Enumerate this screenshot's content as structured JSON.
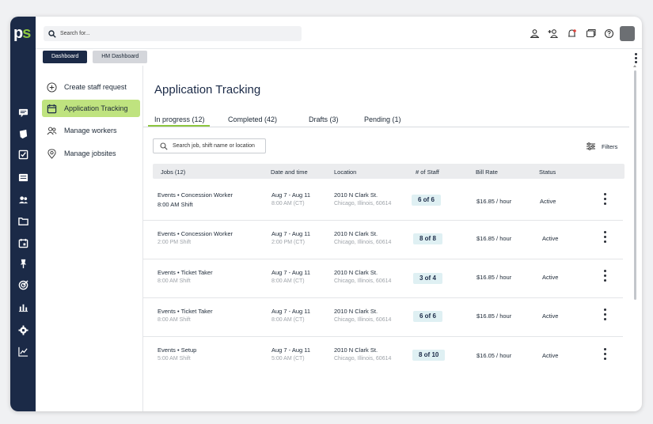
{
  "logo": {
    "p": "p",
    "s": "s"
  },
  "search": {
    "placeholder": "Search for..."
  },
  "subtabs": {
    "dashboard": "Dashboard",
    "hm_dashboard": "HM Dashboard"
  },
  "sidebar": {
    "items": [
      {
        "label": "Create staff request",
        "icon": "plus-circle-icon"
      },
      {
        "label": "Application Tracking",
        "icon": "calendar-icon"
      },
      {
        "label": "Manage workers",
        "icon": "people-icon"
      },
      {
        "label": "Manage jobsites",
        "icon": "location-pin-icon"
      }
    ]
  },
  "rail_icons": [
    "chat-icon",
    "shield-icon",
    "checklist-icon",
    "id-card-icon",
    "users-icon",
    "folder-icon",
    "calendar-icon",
    "pin-icon",
    "target-icon",
    "bar-chart-icon",
    "gear-icon",
    "line-chart-icon"
  ],
  "main": {
    "title": "Application Tracking",
    "tabs": [
      "In progress (12)",
      "Completed (42)",
      "Drafts (3)",
      "Pending (1)"
    ],
    "search_placeholder": "Search job, shift name or location",
    "filters_label": "Filters",
    "columns": [
      "Jobs (12)",
      "Date and time",
      "Location",
      "# of Staff",
      "Bill Rate",
      "Status"
    ],
    "rows": [
      {
        "job": "Events  •  Concession Worker",
        "shift": "8:00 AM Shift",
        "date": "Aug 7 - Aug 11",
        "time": "8:00 AM (CT)",
        "address": "2010 N Clark St.",
        "city": "Chicago, Illinois, 60614",
        "staff": "6 of 6",
        "rate": "$16.85 / hour",
        "status": "Active"
      },
      {
        "job": "Events  •  Concession Worker",
        "shift": "2:00 PM Shift",
        "date": "Aug 7 - Aug 11",
        "time": "2:00 PM (CT)",
        "address": "2010 N Clark St.",
        "city": "Chicago, Illinois, 60614",
        "staff": "8 of 8",
        "rate": "$16.85 / hour",
        "status": "Active"
      },
      {
        "job": "Events  •  Ticket Taker",
        "shift": "8:00 AM Shift",
        "date": "Aug 7 - Aug 11",
        "time": "8:00 AM (CT)",
        "address": "2010 N Clark St.",
        "city": "Chicago, Illinois, 60614",
        "staff": "3 of 4",
        "rate": "$16.85 / hour",
        "status": "Active"
      },
      {
        "job": "Events  •  Ticket Taker",
        "shift": "8:00 AM Shift",
        "date": "Aug 7 - Aug 11",
        "time": "8:00 AM (CT)",
        "address": "2010 N Clark St.",
        "city": "Chicago, Illinois, 60614",
        "staff": "6 of 6",
        "rate": "$16.85 / hour",
        "status": "Active"
      },
      {
        "job": "Events  •  Setup",
        "shift": "5:00 AM Shift",
        "date": "Aug 7 - Aug 11",
        "time": "5:00 AM (CT)",
        "address": "2010 N Clark St.",
        "city": "Chicago, Illinois, 60614",
        "staff": "8 of 10",
        "rate": "$16.05 / hour",
        "status": "Active"
      }
    ]
  },
  "colors": {
    "navy": "#1b2a47",
    "green": "#8dc63f",
    "active_nav": "#bfe37f",
    "badge": "#dff0f3"
  }
}
